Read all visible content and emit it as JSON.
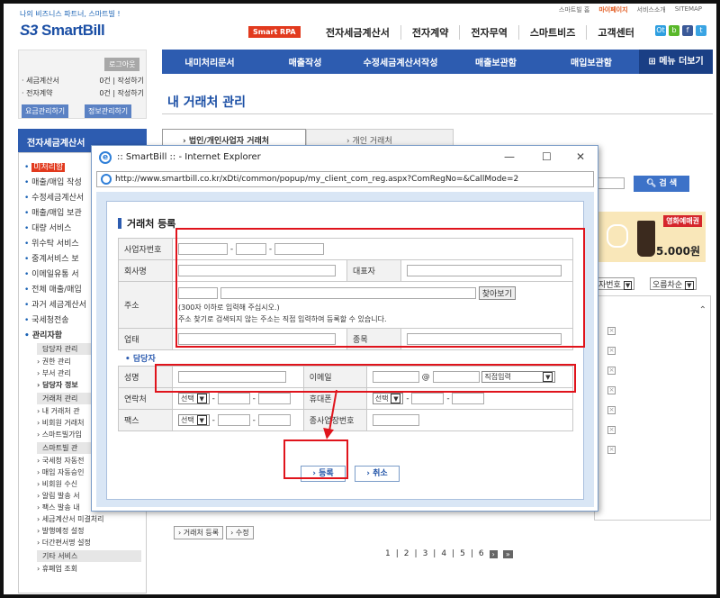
{
  "header": {
    "slogan": "나의 비즈니스 파트너, 스마트빌 !",
    "logo_prefix": "S3",
    "logo_text": "SmartBill",
    "top_links": [
      "스마트빌 홈",
      "마이페이지",
      "서비스소개",
      "SITEMAP"
    ],
    "rpa_badge": "Smart RPA",
    "gnb": [
      "전자세금계산서",
      "전자계약",
      "전자무역",
      "스마트비즈",
      "고객센터"
    ],
    "social": [
      {
        "label": "Ot",
        "color": "#2f9fe0"
      },
      {
        "label": "b",
        "color": "#59b82a"
      },
      {
        "label": "f",
        "color": "#3b5998"
      },
      {
        "label": "t",
        "color": "#3aa4e3"
      }
    ]
  },
  "login": {
    "login_button": "로그아웃",
    "rows": [
      {
        "label": "· 세금계산서",
        "value": "0건 | 작성하기"
      },
      {
        "label": "· 전자계약",
        "value": "0건 | 작성하기"
      }
    ],
    "buttons": [
      "요금관리하기",
      "정보관리하기"
    ]
  },
  "subnav": [
    "내미처리문서",
    "매출작성",
    "수정세금계산서작성",
    "매출보관함",
    "매입보관함"
  ],
  "subnav_more": "⊞ 메뉴 더보기",
  "page_title": "내 거래처 관리",
  "left_menu": {
    "head": "전자세금계산서",
    "items": [
      "미처리함",
      "매출/매입 작성",
      "수정세금계산서",
      "매출/매입 보관",
      "대량 서비스",
      "위수탁 서비스",
      "중계서비스 보",
      "이메일유통 서",
      "전체 매출/매입",
      "과거 세금계산서",
      "국세청전송",
      "관리자함"
    ],
    "subgroups": {
      "g1": "담당자 관리",
      "g1_items": [
        "권한 관리",
        "부서 관리",
        "담당자 정보"
      ],
      "g2": "거래처 관리",
      "g2_items": [
        "내 거래처 관",
        "비회원 거래처",
        "스마트빌가입"
      ],
      "g3": "스마트빌 관",
      "g3_items": [
        "국세청 자동전",
        "매입 자동승인",
        "비회원 수신",
        "알림 발송 서",
        "팩스 발송 내",
        "세금계산서 미결처리",
        "발행예정 설정",
        "더간편서명 설정"
      ],
      "g4": "기타 서비스",
      "g4_items": [
        "휴폐업 조회"
      ]
    }
  },
  "tabs": [
    "법인/개인사업자 거래처",
    "개인 거래처"
  ],
  "search_button": "검 색",
  "ad": {
    "badge": "영화예매권",
    "price": "5.000원"
  },
  "sort": {
    "left": "자번호",
    "right": "오름차순"
  },
  "bottom_buttons": [
    "› 거래처 등록",
    "› 수정"
  ],
  "paging": [
    "1",
    "2",
    "3",
    "4",
    "5",
    "6"
  ],
  "popup": {
    "title": ":: SmartBill :: - Internet Explorer",
    "url": "http://www.smartbill.co.kr/xDti/common/popup/my_client_com_reg.aspx?ComRegNo=&CallMode=2",
    "section_title": "거래처 등록",
    "labels": {
      "bizno": "사업자번호",
      "company": "회사명",
      "ceo": "대표자",
      "address": "주소",
      "find": "찾아보기",
      "addr_note1": "(300자 이하로 입력해 주십시오.)",
      "addr_note2": "주소 찾기로 검색되지 않는 주소는 직접 입력하여 등록할 수 있습니다.",
      "biztype": "업태",
      "bizitem": "종목"
    },
    "contact": {
      "section": "담당자",
      "name": "성명",
      "email": "이메일",
      "at": "@",
      "email_select": "직접입력",
      "phone": "연락처",
      "mobile": "휴대폰",
      "fax": "팩스",
      "branch": "종사업장번호",
      "select": "선택",
      "dash": "-"
    },
    "register_button": "› 등록",
    "cancel_button": "› 취소"
  },
  "annotation_color": "#e0141c"
}
